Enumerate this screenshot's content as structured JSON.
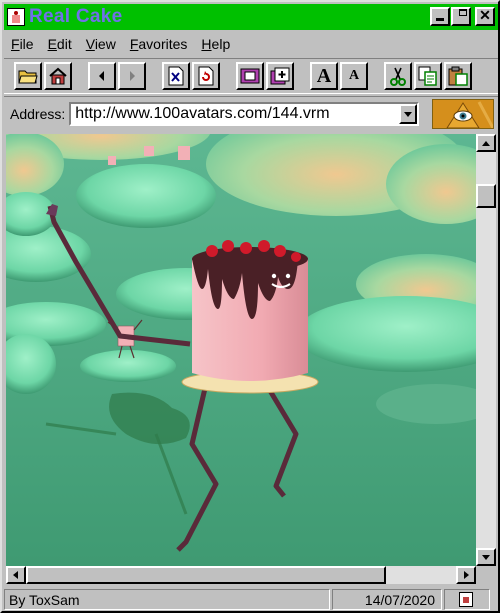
{
  "window": {
    "title": "Real Cake"
  },
  "menu": {
    "items": [
      {
        "key": "F",
        "rest": "ile"
      },
      {
        "key": "E",
        "rest": "dit"
      },
      {
        "key": "V",
        "rest": "iew"
      },
      {
        "key": "F",
        "rest": "avorites"
      },
      {
        "key": "H",
        "rest": "elp"
      }
    ]
  },
  "toolbar": {
    "buttons": [
      "open-folder-icon",
      "home-icon",
      "back-icon",
      "forward-icon",
      "stop-icon",
      "refresh-icon",
      "save-icon",
      "new-page-icon",
      "font-larger-icon",
      "font-smaller-icon",
      "cut-icon",
      "copy-icon",
      "paste-icon"
    ],
    "font_larger_glyph": "A",
    "font_smaller_glyph": "A"
  },
  "address": {
    "label": "Address:",
    "value": "http://www.100avatars.com/144.vrm"
  },
  "status": {
    "left": "By ToxSam",
    "right": "14/07/2020"
  },
  "colors": {
    "titlebar": "#00c000",
    "title_text": "#7070e8",
    "scene_background": "#56a883",
    "cake_body": "#f2b0b6"
  }
}
